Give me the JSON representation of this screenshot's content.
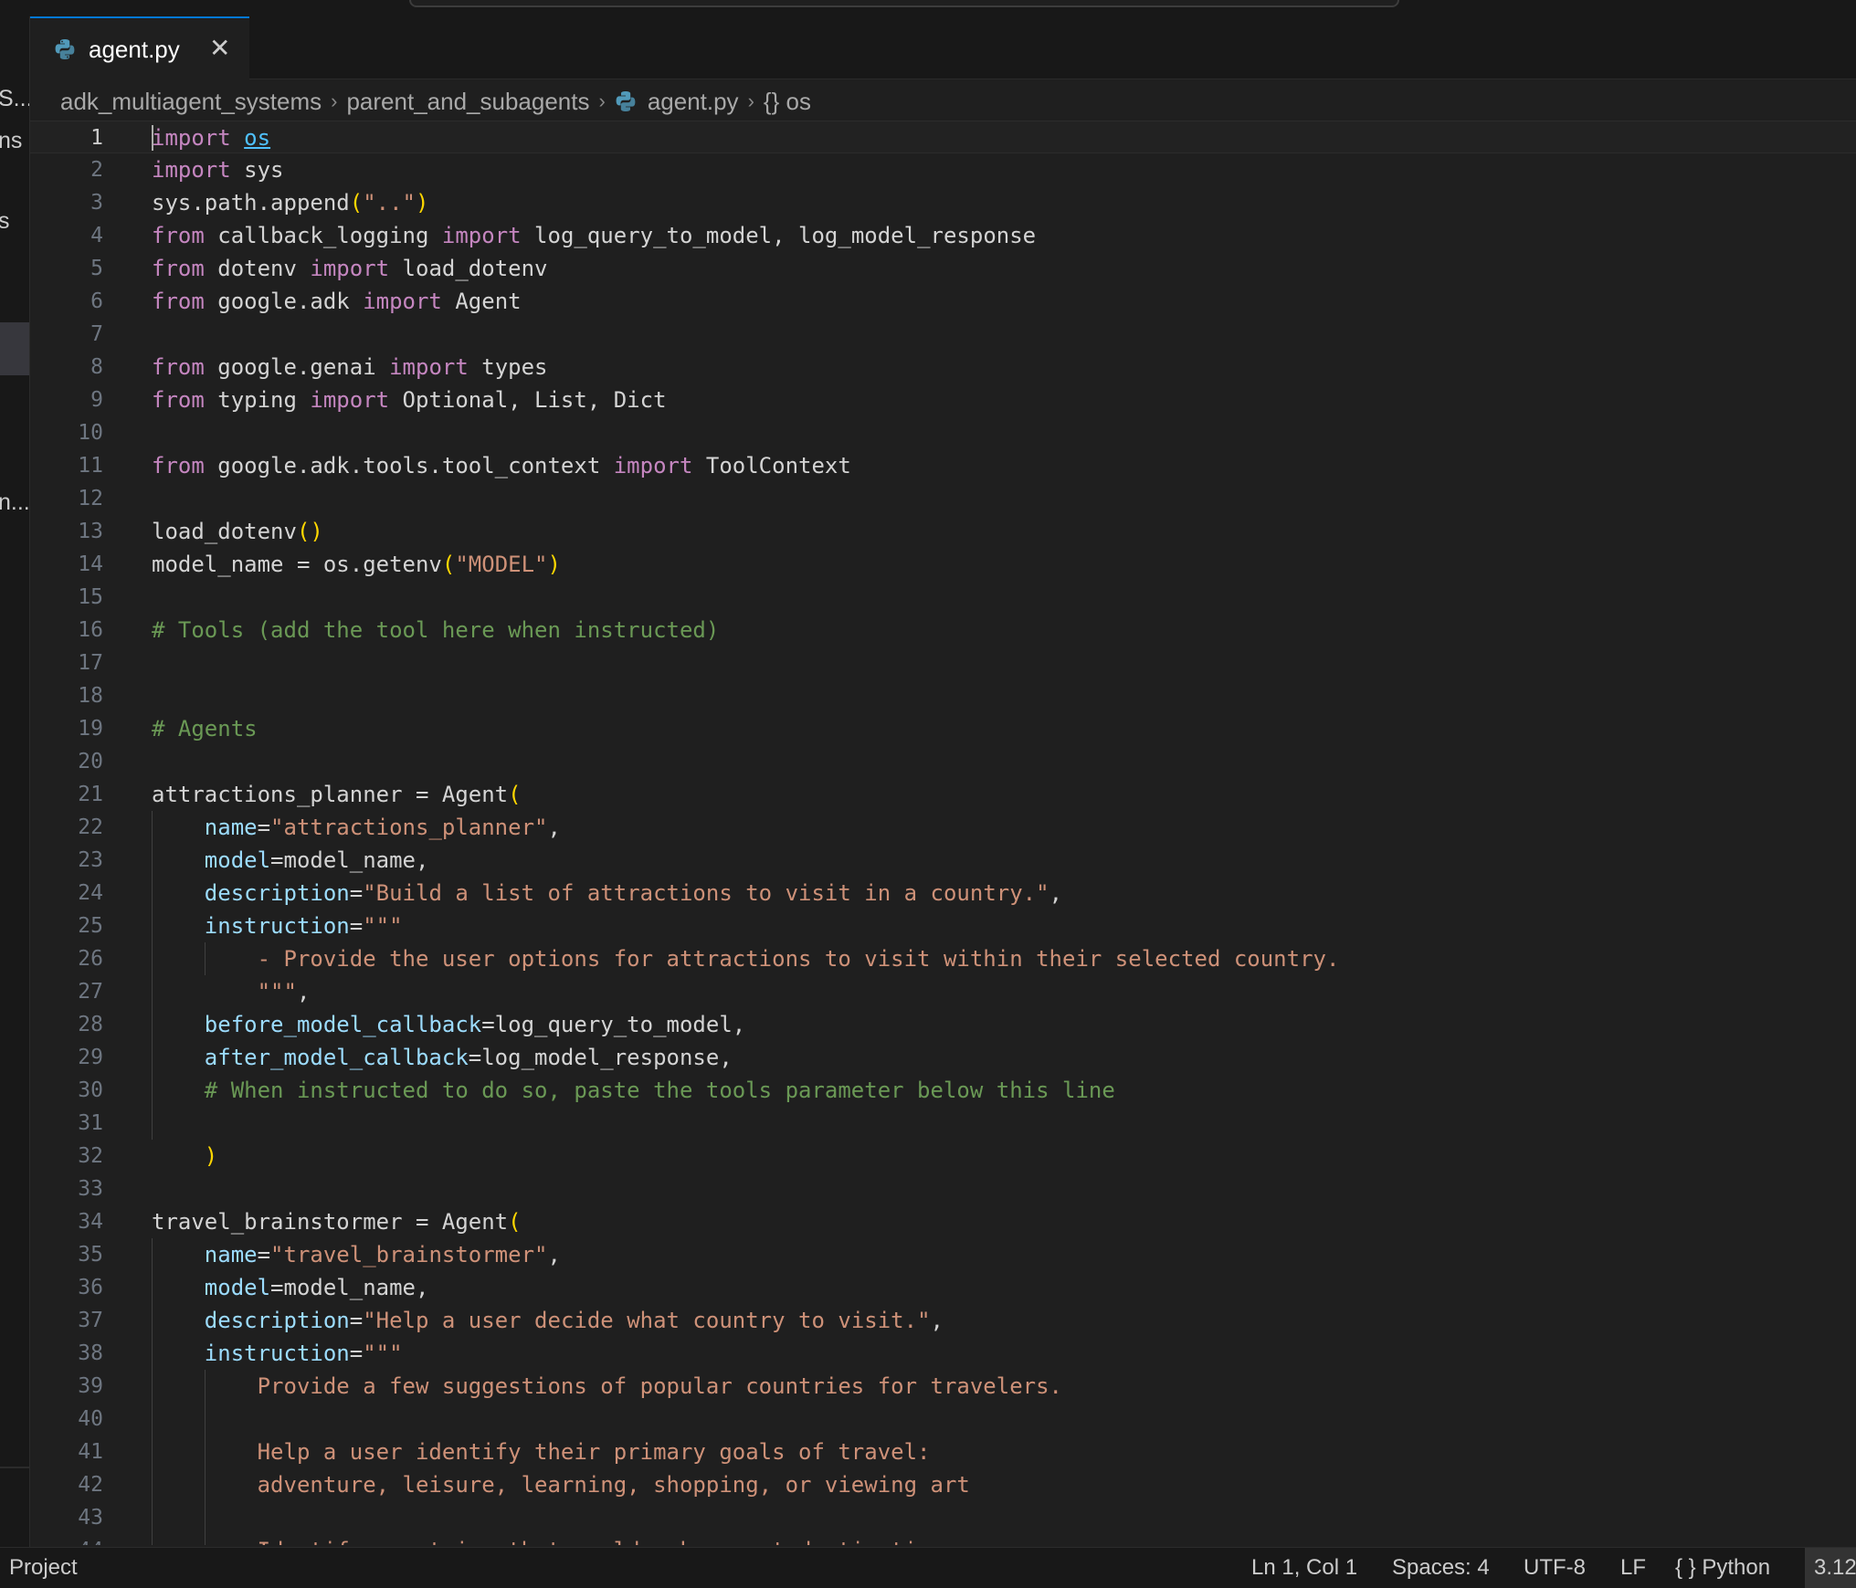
{
  "tab": {
    "label": "agent.py",
    "close": "✕"
  },
  "sidebar_fragments": [
    "S...",
    "ns",
    "s",
    "n..."
  ],
  "breadcrumb": {
    "items": [
      "adk_multiagent_systems",
      "parent_and_subagents",
      "agent.py",
      "{} os"
    ],
    "sep": "›"
  },
  "code_lines": [
    [
      [
        "kw",
        "import"
      ],
      [
        "",
        ""
      ],
      [
        "mod",
        "os"
      ]
    ],
    [
      [
        "kw",
        "import"
      ],
      [
        "",
        " sys"
      ]
    ],
    [
      [
        "",
        "sys.path.append"
      ],
      [
        "paren",
        "("
      ],
      [
        "str",
        "\"..\""
      ],
      [
        "paren",
        ")"
      ]
    ],
    [
      [
        "kw",
        "from"
      ],
      [
        "",
        " callback_logging "
      ],
      [
        "kw",
        "import"
      ],
      [
        "",
        " log_query_to_model, log_model_response"
      ]
    ],
    [
      [
        "kw",
        "from"
      ],
      [
        "",
        " dotenv "
      ],
      [
        "kw",
        "import"
      ],
      [
        "",
        " load_dotenv"
      ]
    ],
    [
      [
        "kw",
        "from"
      ],
      [
        "",
        " google.adk "
      ],
      [
        "kw",
        "import"
      ],
      [
        "",
        " Agent"
      ]
    ],
    [],
    [
      [
        "kw",
        "from"
      ],
      [
        "",
        " google.genai "
      ],
      [
        "kw",
        "import"
      ],
      [
        "",
        " types"
      ]
    ],
    [
      [
        "kw",
        "from"
      ],
      [
        "",
        " typing "
      ],
      [
        "kw",
        "import"
      ],
      [
        "",
        " Optional, List, Dict"
      ]
    ],
    [],
    [
      [
        "kw",
        "from"
      ],
      [
        "",
        " google.adk.tools.tool_context "
      ],
      [
        "kw",
        "import"
      ],
      [
        "",
        " ToolContext"
      ]
    ],
    [],
    [
      [
        "",
        "load_dotenv"
      ],
      [
        "paren",
        "()"
      ]
    ],
    [
      [
        "",
        "model_name = os.getenv"
      ],
      [
        "paren",
        "("
      ],
      [
        "str",
        "\"MODEL\""
      ],
      [
        "paren",
        ")"
      ]
    ],
    [],
    [
      [
        "cm",
        "# Tools (add the tool here when instructed)"
      ]
    ],
    [],
    [],
    [
      [
        "cm",
        "# Agents"
      ]
    ],
    [],
    [
      [
        "",
        "attractions_planner = Agent"
      ],
      [
        "paren",
        "("
      ]
    ],
    [
      [
        "",
        "    "
      ],
      [
        "param",
        "name"
      ],
      [
        "",
        "="
      ],
      [
        "str",
        "\"attractions_planner\""
      ],
      [
        "",
        ","
      ]
    ],
    [
      [
        "",
        "    "
      ],
      [
        "param",
        "model"
      ],
      [
        "",
        "=model_name,"
      ]
    ],
    [
      [
        "",
        "    "
      ],
      [
        "param",
        "description"
      ],
      [
        "",
        "="
      ],
      [
        "str",
        "\"Build a list of attractions to visit in a country.\""
      ],
      [
        "",
        ","
      ]
    ],
    [
      [
        "",
        "    "
      ],
      [
        "param",
        "instruction"
      ],
      [
        "",
        "="
      ],
      [
        "str",
        "\"\"\""
      ]
    ],
    [
      [
        "str",
        "        - Provide the user options for attractions to visit within their selected country."
      ]
    ],
    [
      [
        "str",
        "        \"\"\""
      ],
      [
        "",
        ","
      ]
    ],
    [
      [
        "",
        "    "
      ],
      [
        "param",
        "before_model_callback"
      ],
      [
        "",
        "=log_query_to_model,"
      ]
    ],
    [
      [
        "",
        "    "
      ],
      [
        "param",
        "after_model_callback"
      ],
      [
        "",
        "=log_model_response,"
      ]
    ],
    [
      [
        "cm",
        "    # When instructed to do so, paste the tools parameter below this line"
      ]
    ],
    [],
    [
      [
        "",
        "    "
      ],
      [
        "paren",
        ")"
      ]
    ],
    [],
    [
      [
        "",
        "travel_brainstormer = Agent"
      ],
      [
        "paren",
        "("
      ]
    ],
    [
      [
        "",
        "    "
      ],
      [
        "param",
        "name"
      ],
      [
        "",
        "="
      ],
      [
        "str",
        "\"travel_brainstormer\""
      ],
      [
        "",
        ","
      ]
    ],
    [
      [
        "",
        "    "
      ],
      [
        "param",
        "model"
      ],
      [
        "",
        "=model_name,"
      ]
    ],
    [
      [
        "",
        "    "
      ],
      [
        "param",
        "description"
      ],
      [
        "",
        "="
      ],
      [
        "str",
        "\"Help a user decide what country to visit.\""
      ],
      [
        "",
        ","
      ]
    ],
    [
      [
        "",
        "    "
      ],
      [
        "param",
        "instruction"
      ],
      [
        "",
        "="
      ],
      [
        "str",
        "\"\"\""
      ]
    ],
    [
      [
        "str",
        "        Provide a few suggestions of popular countries for travelers."
      ]
    ],
    [],
    [
      [
        "str",
        "        Help a user identify their primary goals of travel:"
      ]
    ],
    [
      [
        "str",
        "        adventure, leisure, learning, shopping, or viewing art"
      ]
    ],
    [],
    [
      [
        "str",
        "        Identify countries that would make great destinations"
      ]
    ]
  ],
  "status": {
    "left": "Project",
    "position": "Ln 1, Col 1",
    "spaces": "Spaces: 4",
    "encoding": "UTF-8",
    "eol": "LF",
    "language": "{ } Python",
    "version": "3.12"
  }
}
